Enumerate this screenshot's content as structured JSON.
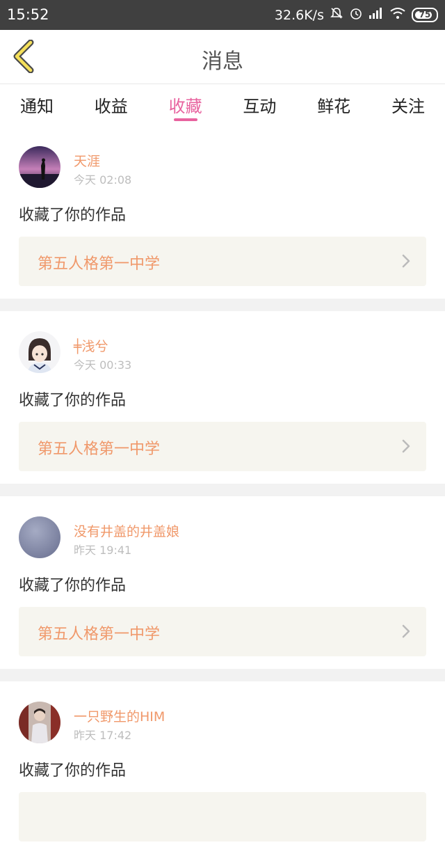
{
  "status_bar": {
    "time": "15:52",
    "network_speed": "32.6K/s",
    "battery": "75",
    "icons": [
      "mute-bell-icon",
      "alarm-icon",
      "signal-icon",
      "wifi-icon",
      "battery-icon"
    ]
  },
  "header": {
    "title": "消息",
    "back_icon": "chevron-left-icon"
  },
  "tabs": [
    {
      "label": "通知"
    },
    {
      "label": "收益"
    },
    {
      "label": "收藏"
    },
    {
      "label": "互动"
    },
    {
      "label": "鲜花"
    },
    {
      "label": "关注"
    }
  ],
  "active_tab": "收藏",
  "accent_color": "#e8639f",
  "name_color": "#f0986a",
  "messages": [
    {
      "user": "天涯",
      "time": "今天 02:08",
      "action": "收藏了你的作品",
      "work": "第五人格第一中学"
    },
    {
      "user": "╪浅兮",
      "time": "今天 00:33",
      "action": "收藏了你的作品",
      "work": "第五人格第一中学"
    },
    {
      "user": "没有井盖的井盖娘",
      "time": "昨天 19:41",
      "action": "收藏了你的作品",
      "work": "第五人格第一中学"
    },
    {
      "user": "一只野生的HIM",
      "time": "昨天 17:42",
      "action": "收藏了你的作品",
      "work": ""
    }
  ]
}
